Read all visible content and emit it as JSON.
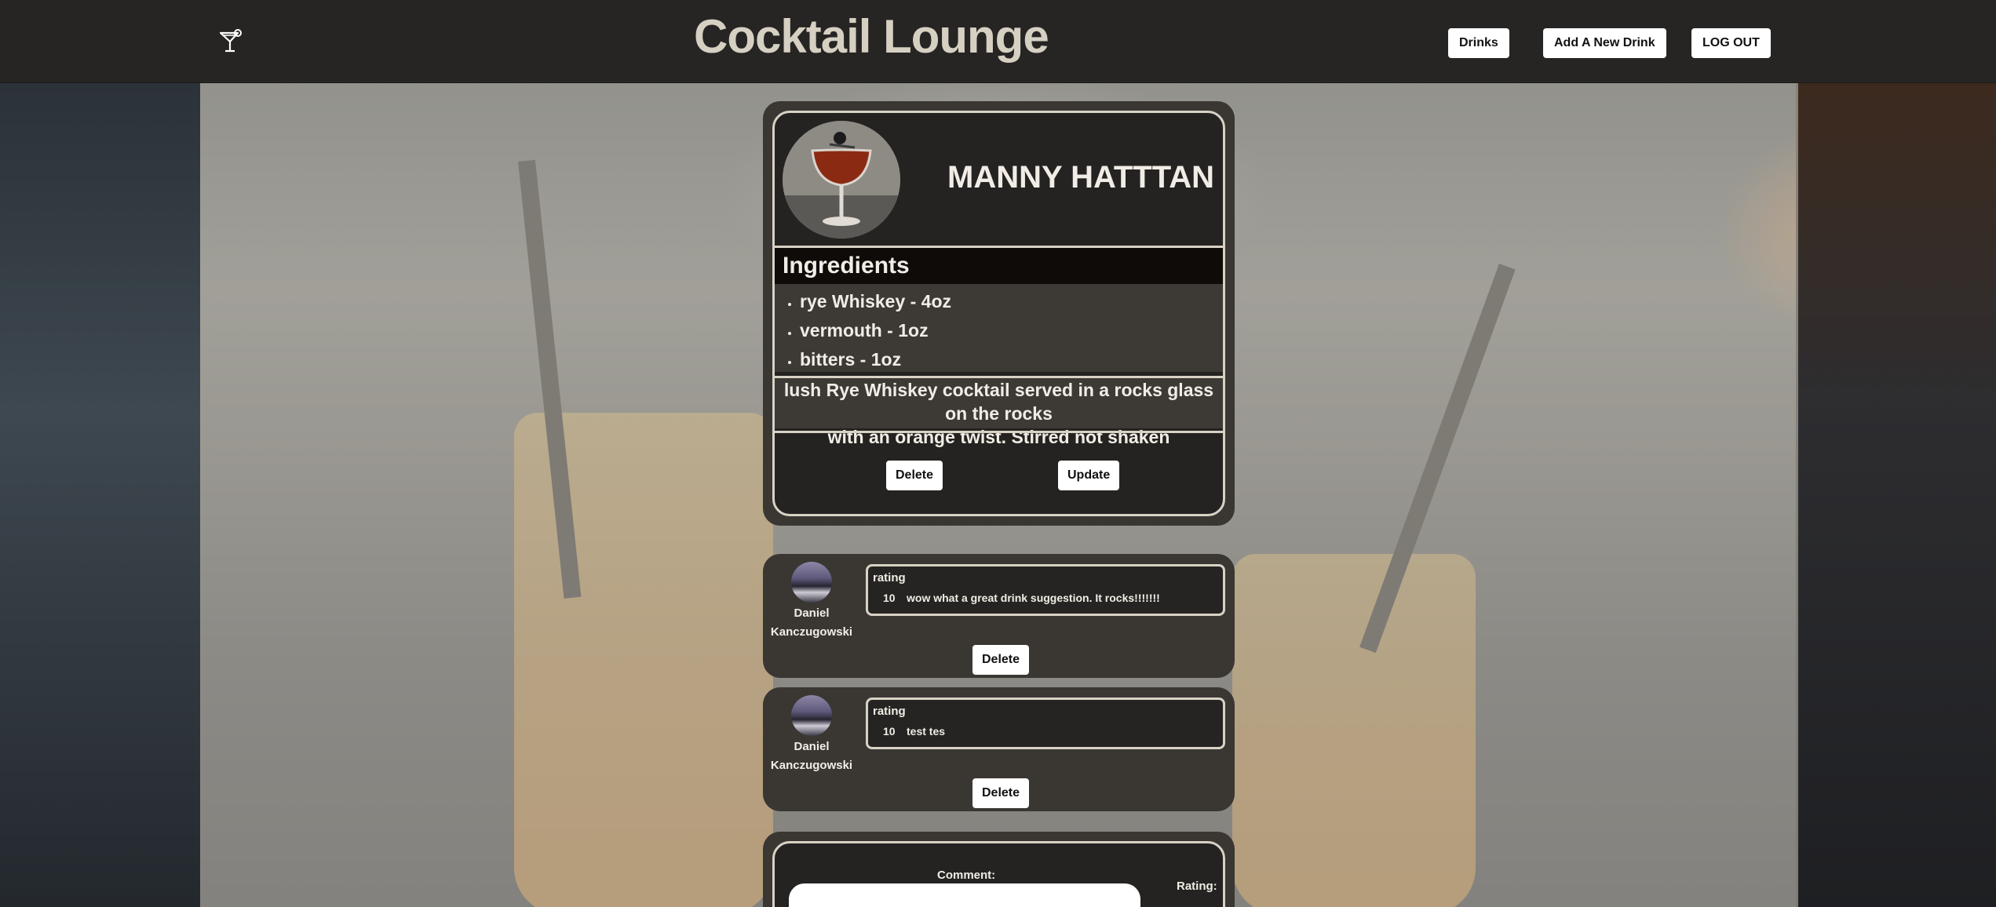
{
  "nav": {
    "logo_icon": "cocktail-glass-icon",
    "title": "Cocktail Lounge",
    "drinks_label": "Drinks",
    "add_drink_label": "Add A New Drink",
    "logout_label": "LOG OUT"
  },
  "drink": {
    "name": "MANNY HATTTAN",
    "ingredients_heading": "Ingredients",
    "ingredients": [
      "rye Whiskey - 4oz",
      "vermouth - 1oz",
      "bitters - 1oz"
    ],
    "description_line1": "lush Rye Whiskey cocktail served in a rocks glass on the rocks",
    "description_line2": "with an orange twist. Stirred not shaken",
    "delete_label": "Delete",
    "update_label": "Update"
  },
  "comments": [
    {
      "author_first": "Daniel",
      "author_last": "Kanczugowski",
      "rating_label": "rating",
      "rating": "10",
      "text": "wow what a great drink suggestion. It rocks!!!!!!!",
      "delete_label": "Delete"
    },
    {
      "author_first": "Daniel",
      "author_last": "Kanczugowski",
      "rating_label": "rating",
      "rating": "10",
      "text": "test tes",
      "delete_label": "Delete"
    }
  ],
  "form": {
    "comment_label": "Comment:",
    "rating_label": "Rating:"
  }
}
